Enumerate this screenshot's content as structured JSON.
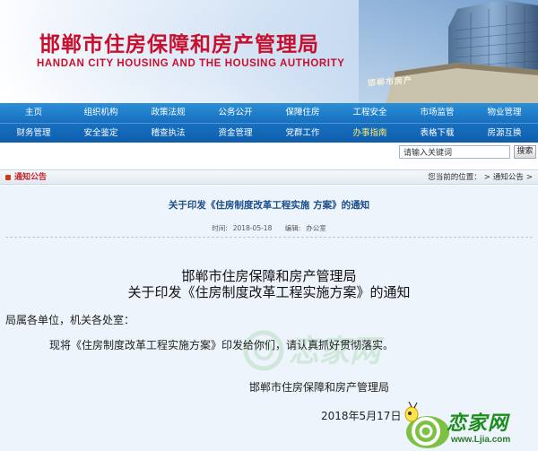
{
  "banner": {
    "title_cn": "邯郸市住房保障和房产管理局",
    "title_en": "HANDAN CITY HOUSING AND THE HOUSING AUTHORITY",
    "building_sign": "邯郸市房产"
  },
  "nav": {
    "row1": [
      "主页",
      "组织机构",
      "政策法规",
      "公务公开",
      "保障住房",
      "工程安全",
      "市场监管",
      "物业管理"
    ],
    "row2": [
      "财务管理",
      "安全鉴定",
      "稽查执法",
      "资金管理",
      "党群工作",
      "办事指南",
      "表格下载",
      "房源互换"
    ]
  },
  "search": {
    "placeholder": "请输入关键词",
    "button": "搜索"
  },
  "section": {
    "label": "通知公告",
    "crumbs": [
      "您当前的位置：",
      ">",
      "通知公告",
      ">"
    ]
  },
  "article": {
    "title": "关于印发《住房制度改革工程实施 方案》的通知",
    "time_label": "时间:",
    "time_value": "2018-05-18",
    "editor_label": "编辑:",
    "editor_value": "办公室",
    "heading_line1": "邯郸市住房保障和房产管理局",
    "heading_line2": "关于印发《住房制度改革工程实施方案》的通知",
    "salutation": "局属各单位，机关各处室：",
    "body": "现将《住房制度改革工程实施方案》印发给你们，请认真抓好贯彻落实。",
    "signature": "邯郸市住房保障和房产管理局",
    "date": "2018年5月17日"
  },
  "watermark": {
    "text": "恋家网",
    "url": "www.Ljia.com"
  },
  "colors": {
    "title_red": "#c8102e",
    "nav_blue": "#1770c0",
    "link_blue": "#1b4f8a",
    "content_bg": "#eef4fb"
  }
}
